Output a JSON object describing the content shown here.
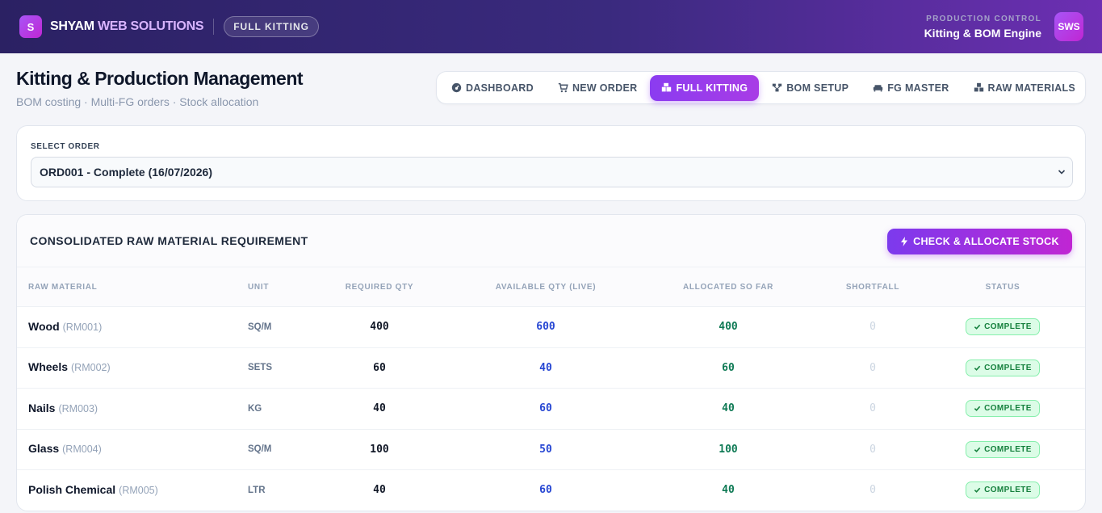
{
  "header": {
    "logo_letter": "S",
    "brand_main": "SHYAM",
    "brand_accent": "WEB SOLUTIONS",
    "module": "FULL KITTING",
    "subtitle": "PRODUCTION CONTROL",
    "engine": "Kitting & BOM Engine",
    "avatar": "SWS"
  },
  "page": {
    "title": "Kitting & Production Management",
    "subtitle": "BOM costing · Multi-FG orders · Stock allocation"
  },
  "nav": {
    "items": [
      {
        "label": "DASHBOARD",
        "icon": "dashboard-icon"
      },
      {
        "label": "NEW ORDER",
        "icon": "cart-icon"
      },
      {
        "label": "FULL KITTING",
        "icon": "boxes-icon",
        "active": true
      },
      {
        "label": "BOM SETUP",
        "icon": "hierarchy-icon"
      },
      {
        "label": "FG MASTER",
        "icon": "sofa-icon"
      },
      {
        "label": "RAW MATERIALS",
        "icon": "cubes-icon"
      }
    ]
  },
  "order_select": {
    "label": "SELECT ORDER",
    "value": "ORD001 - Complete (16/07/2026)"
  },
  "table": {
    "title": "CONSOLIDATED RAW MATERIAL REQUIREMENT",
    "action_label": "CHECK & ALLOCATE STOCK",
    "columns": [
      "RAW MATERIAL",
      "UNIT",
      "REQUIRED QTY",
      "AVAILABLE QTY (LIVE)",
      "ALLOCATED SO FAR",
      "SHORTFALL",
      "STATUS"
    ],
    "rows": [
      {
        "name": "Wood",
        "code": "(RM001)",
        "unit": "SQ/M",
        "required": "400",
        "available": "600",
        "allocated": "400",
        "shortfall": "0",
        "status": "COMPLETE"
      },
      {
        "name": "Wheels",
        "code": "(RM002)",
        "unit": "SETS",
        "required": "60",
        "available": "40",
        "allocated": "60",
        "shortfall": "0",
        "status": "COMPLETE"
      },
      {
        "name": "Nails",
        "code": "(RM003)",
        "unit": "KG",
        "required": "40",
        "available": "60",
        "allocated": "40",
        "shortfall": "0",
        "status": "COMPLETE"
      },
      {
        "name": "Glass",
        "code": "(RM004)",
        "unit": "SQ/M",
        "required": "100",
        "available": "50",
        "allocated": "100",
        "shortfall": "0",
        "status": "COMPLETE"
      },
      {
        "name": "Polish Chemical",
        "code": "(RM005)",
        "unit": "LTR",
        "required": "40",
        "available": "60",
        "allocated": "40",
        "shortfall": "0",
        "status": "COMPLETE"
      }
    ]
  }
}
